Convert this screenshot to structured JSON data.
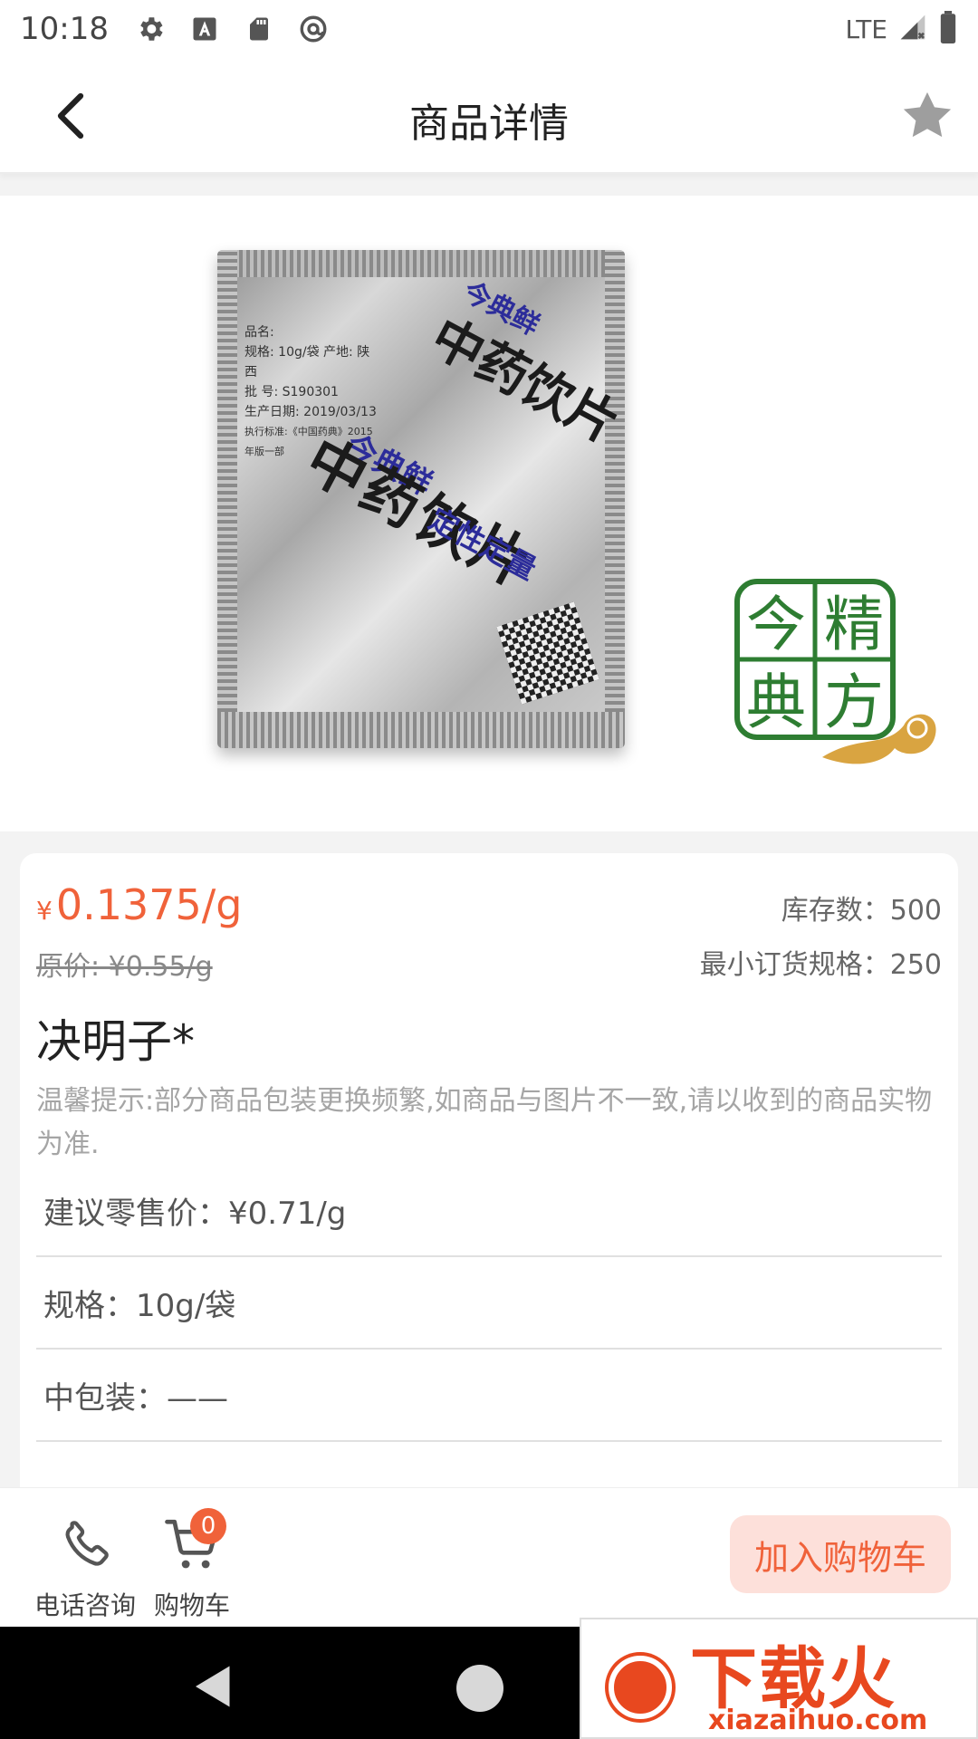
{
  "status_bar": {
    "time": "10:18",
    "network": "LTE",
    "icons": [
      "settings-icon",
      "text-a-icon",
      "sd-card-icon",
      "at-sign-icon",
      "signal-icon",
      "battery-icon"
    ]
  },
  "app_bar": {
    "title": "商品详情",
    "icons": [
      "back-chevron-icon",
      "star-icon"
    ]
  },
  "hero": {
    "pouch_brand": "今典鲜",
    "pouch_title": "中药饮片",
    "pouch_subtitle": "定性定量",
    "pouch_label_lines": [
      "品名:",
      "规格: 10g/袋  产地: 陕西",
      "批  号: S190301",
      "生产日期: 2019/03/13",
      "执行标准:《中国药典》2015年版一部"
    ],
    "logo_chars": [
      "今",
      "精",
      "典",
      "方"
    ]
  },
  "product": {
    "currency_symbol": "¥",
    "price": "0.1375/g",
    "original_price": "原价: ¥0.55/g",
    "stock": "库存数：500",
    "min_order": "最小订货规格：250",
    "name": "决明子*",
    "tip": "温馨提示:部分商品包装更换频繁,如商品与图片不一致,请以收到的商品实物为准.",
    "rows": [
      {
        "label": "建议零售价：¥0.71/g"
      },
      {
        "label": "规格：10g/袋"
      },
      {
        "label": "中包装：——"
      }
    ]
  },
  "actions": {
    "phone_label": "电话咨询",
    "cart_label": "购物车",
    "cart_count": "0",
    "add_to_cart": "加入购物车"
  },
  "watermark": {
    "brand": "下载火",
    "url": "xiazaihuo.com"
  },
  "colors": {
    "accent": "#f0623a",
    "accent_bg": "#fde0da",
    "logo_green": "#2e7d32",
    "logo_gold": "#d9a441"
  }
}
